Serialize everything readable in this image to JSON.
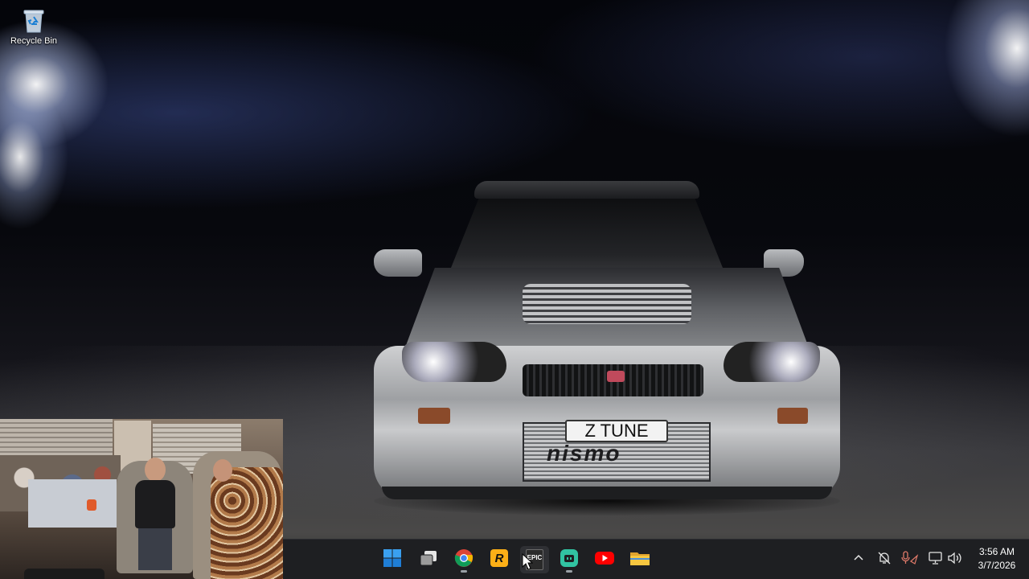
{
  "desktop": {
    "icons": [
      {
        "label": "Recycle Bin",
        "icon": "recycle-bin-icon"
      }
    ],
    "wallpaper": {
      "plate_text": "Z  TUNE",
      "badge_text": "nismo"
    }
  },
  "taskbar": {
    "apps": [
      {
        "name": "Start",
        "icon": "windows-start-icon",
        "running": false
      },
      {
        "name": "Task View",
        "icon": "task-view-icon",
        "running": false
      },
      {
        "name": "Google Chrome",
        "icon": "chrome-icon",
        "running": true
      },
      {
        "name": "Rockstar Games Launcher",
        "icon": "rockstar-icon",
        "running": false
      },
      {
        "name": "Epic Games Launcher",
        "icon": "epic-games-icon",
        "running": false,
        "label": "EPIC"
      },
      {
        "name": "Streamlabs",
        "icon": "streamlabs-icon",
        "running": true
      },
      {
        "name": "YouTube",
        "icon": "youtube-icon",
        "running": false
      },
      {
        "name": "File Explorer",
        "icon": "file-explorer-icon",
        "running": false
      }
    ],
    "tray": {
      "icons": [
        "chevron-up-icon",
        "notifications-off-icon",
        "microphone-icon",
        "network-icon",
        "volume-icon"
      ],
      "time": "3:56 AM",
      "date": "3/7/2026"
    }
  },
  "colors": {
    "taskbar_bg": "#1e1f22",
    "accent_blue": "#0f6cbd",
    "rockstar_yellow": "#fcaf17",
    "streamlabs_green": "#31c3a2",
    "youtube_red": "#ff0000",
    "folder_yellow": "#f7c640"
  }
}
